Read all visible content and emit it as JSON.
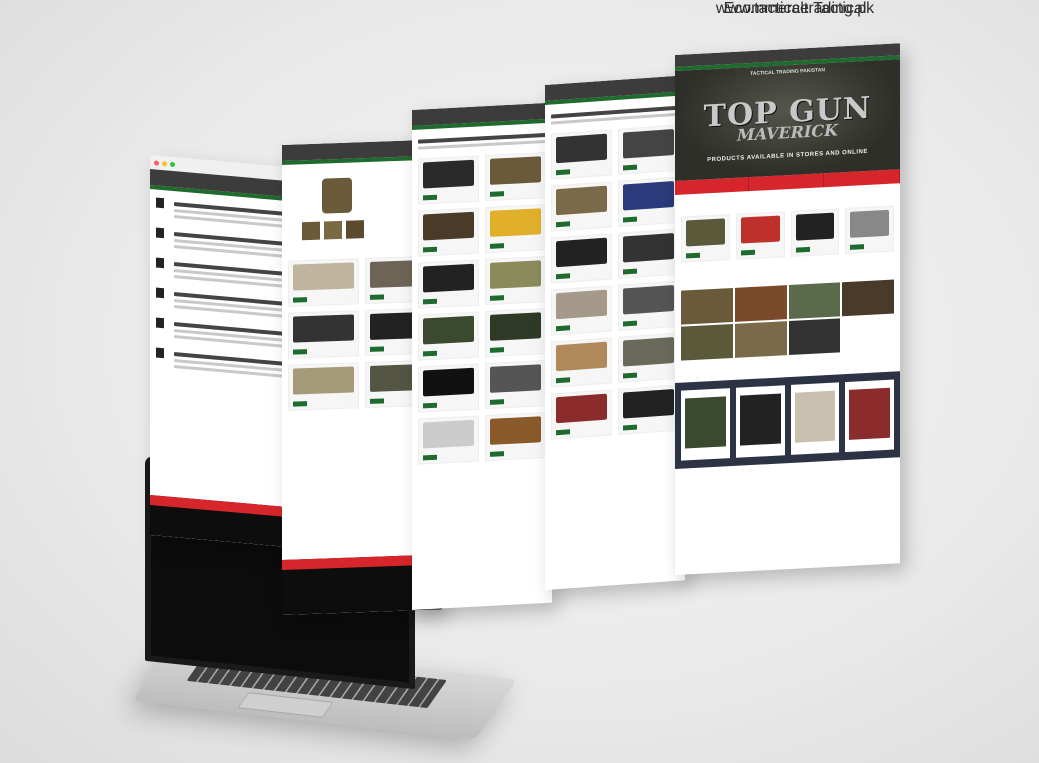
{
  "caption": {
    "url": "www.tacticaltrading.pk",
    "tagline": "Ecommerce Tactical"
  },
  "hero": {
    "title": "TOP GUN",
    "subtitle": "MAVERICK",
    "tagline": "PRODUCTS AVAILABLE IN STORES AND ONLINE",
    "brand": "TACTICAL TRADING PAKISTAN"
  },
  "laptop": {
    "brand": "TACTICAL TRADING PAKISTAN"
  },
  "colors": {
    "brand_green": "#1f6b2e",
    "brand_red": "#d7262b",
    "header_dark": "#3c3c3c",
    "footer_black": "#0d0d0d",
    "navy_section": "#2c3344"
  }
}
